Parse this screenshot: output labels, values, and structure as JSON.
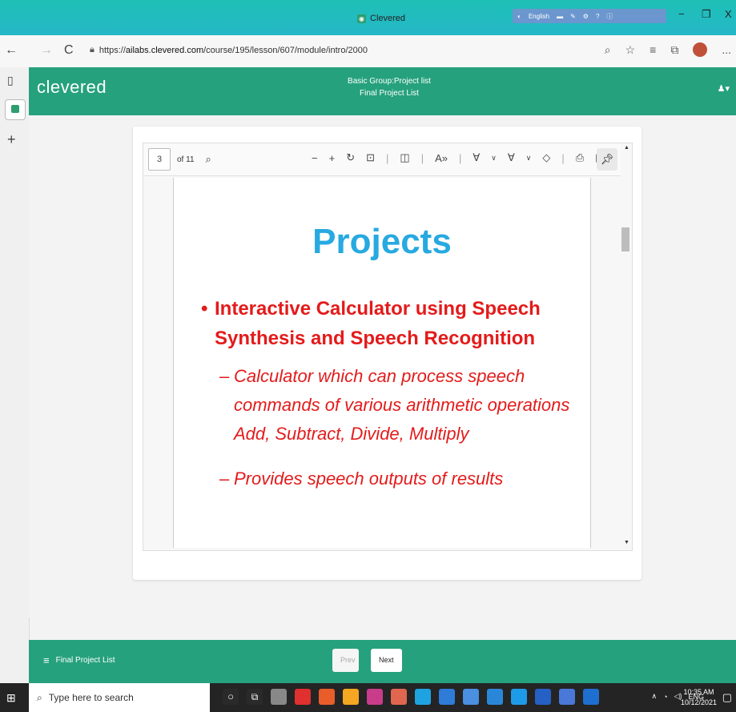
{
  "window": {
    "title": "Clevered",
    "minimize": "−",
    "restore": "❐",
    "close": "X",
    "lang_label": "English"
  },
  "browser": {
    "back": "←",
    "forward": "→",
    "reload": "C",
    "url_prefix": "https://",
    "url_host": "ailabs.clevered.com",
    "url_path": "/course/195/lesson/607/module/intro/2000",
    "more": "..."
  },
  "sidebar": {
    "tabs_icon": "▯",
    "add": "+"
  },
  "app": {
    "logo": "clevered",
    "header_line1": "Basic Group:Project list",
    "header_line2": "Final Project List",
    "user_icon": "♟▾"
  },
  "pdf": {
    "page_input": "3",
    "page_count": "of 11",
    "slide_title": "Projects",
    "bullet_main": "Interactive Calculator using Speech Synthesis and Speech Recognition",
    "sub_bullets": [
      "Calculator which can process speech commands of various arithmetic operations Add, Subtract, Divide, Multiply",
      "Provides speech outputs of results"
    ],
    "colors": {
      "title": "#27a9e1",
      "bullet": "#e31b1b"
    }
  },
  "footer": {
    "menu_label": "Final Project List",
    "prev": "Prev",
    "next": "Next"
  },
  "taskbar": {
    "search_placeholder": "Type here to search",
    "lang": "ENG",
    "time": "10:35 AM",
    "date": "10/12/2021"
  }
}
